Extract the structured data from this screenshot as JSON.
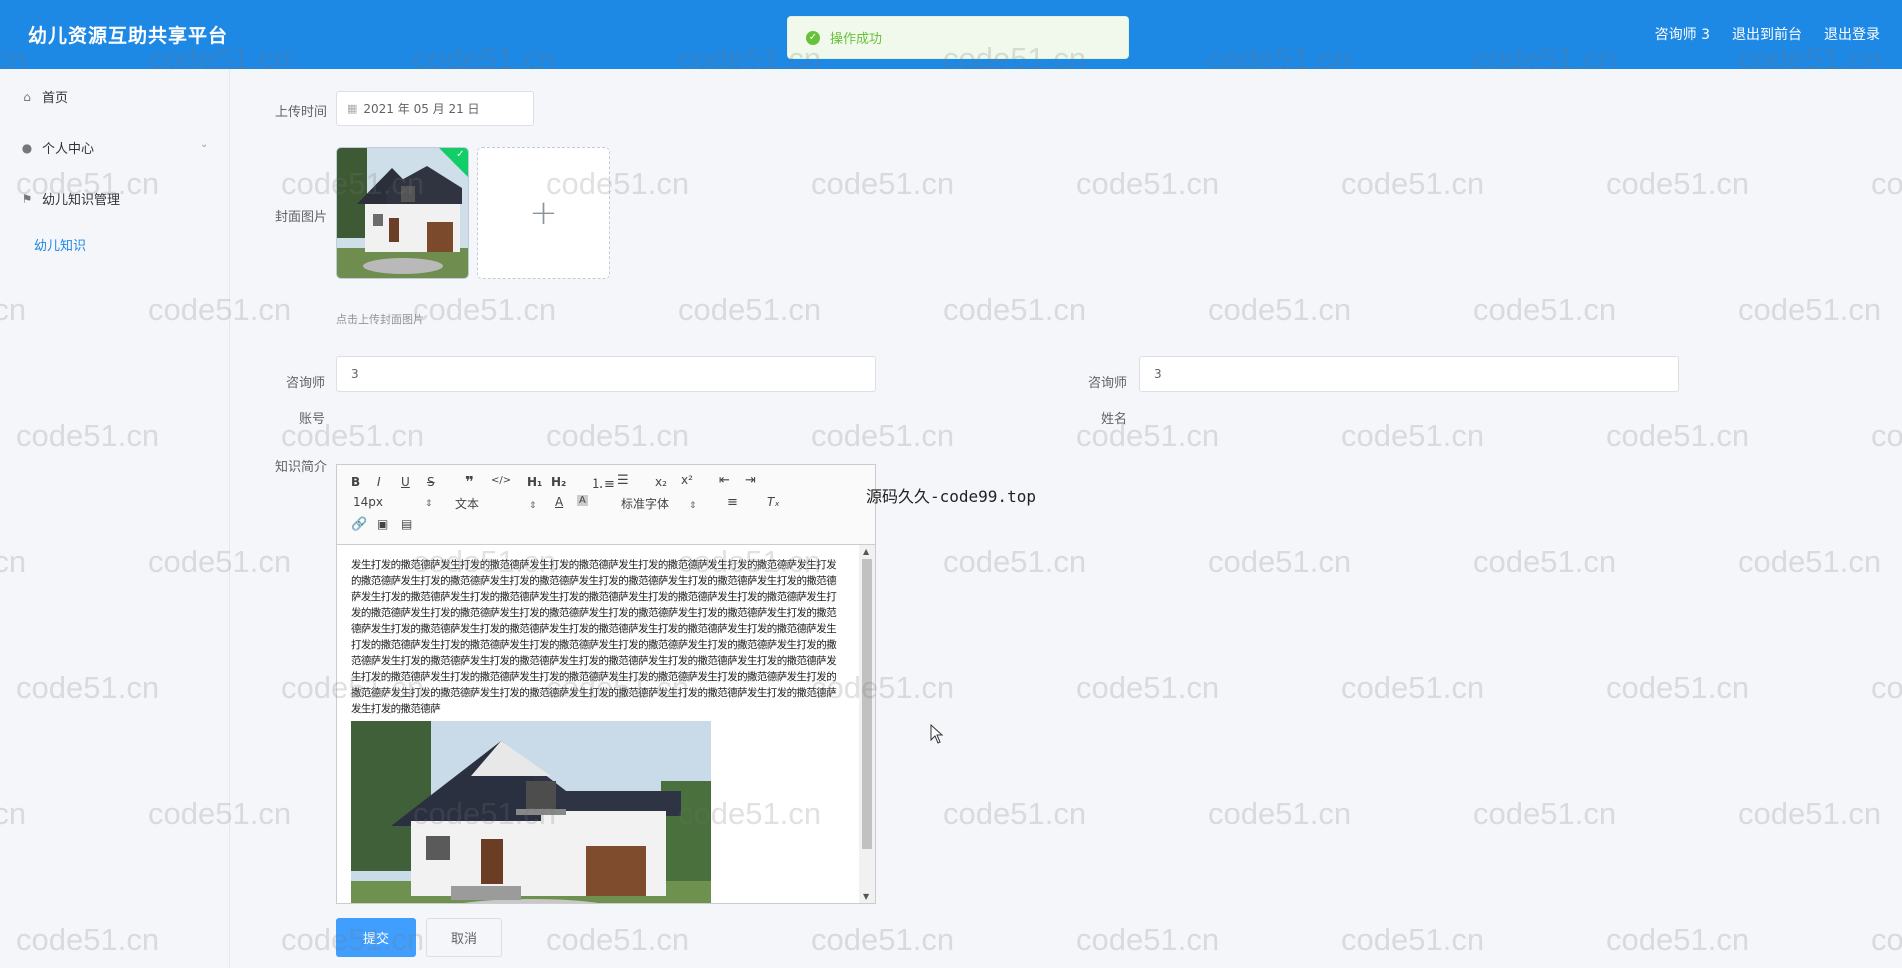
{
  "header": {
    "title": "幼儿资源互助共享平台",
    "user": "咨询师 3",
    "back_front": "退出到前台",
    "logout": "退出登录"
  },
  "toast": {
    "message": "操作成功"
  },
  "sidebar": {
    "home": "首页",
    "personal": "个人中心",
    "knowledge_mgmt": "幼儿知识管理",
    "knowledge": "幼儿知识"
  },
  "form": {
    "upload_time_label": "上传时间",
    "upload_time_value": "2021 年 05 月 21 日",
    "cover_label": "封面图片",
    "cover_hint": "点击上传封面图片",
    "account_label": "咨询师账号",
    "account_value": "3",
    "name_label": "咨询师姓名",
    "name_value": "3",
    "intro_label": "知识简介"
  },
  "editor": {
    "font_size": "14px",
    "text_type": "文本",
    "font_family": "标准字体",
    "content": "发生打发的撒范德萨发生打发的撒范德萨发生打发的撒范德萨发生打发的撒范德萨发生打发的撒范德萨发生打发的撒范德萨发生打发的撒范德萨发生打发的撒范德萨发生打发的撒范德萨发生打发的撒范德萨发生打发的撒范德萨发生打发的撒范德萨发生打发的撒范德萨发生打发的撒范德萨发生打发的撒范德萨发生打发的撒范德萨发生打发的撒范德萨发生打发的撒范德萨发生打发的撒范德萨发生打发的撒范德萨发生打发的撒范德萨发生打发的撒范德萨发生打发的撒范德萨发生打发的撒范德萨发生打发的撒范德萨发生打发的撒范德萨发生打发的撒范德萨发生打发的撒范德萨发生打发的撒范德萨发生打发的撒范德萨发生打发的撒范德萨发生打发的撒范德萨发生打发的撒范德萨发生打发的撒范德萨发生打发的撒范德萨发生打发的撒范德萨发生打发的撒范德萨发生打发的撒范德萨发生打发的撒范德萨发生打发的撒范德萨发生打发的撒范德萨发生打发的撒范德萨发生打发的撒范德萨发生打发的撒范德萨发生打发的撒范德萨发生打发的撒范德萨发生打发的撒范德萨发生打发的撒范德萨发生打发的撒范德萨发生打发的撒范德萨"
  },
  "buttons": {
    "submit": "提交",
    "cancel": "取消"
  },
  "overlay_text": "源码久久-code99.top",
  "watermark": "code51.cn",
  "colors": {
    "header": "#1e88e5",
    "primary": "#409eff",
    "success": "#67c23a"
  }
}
